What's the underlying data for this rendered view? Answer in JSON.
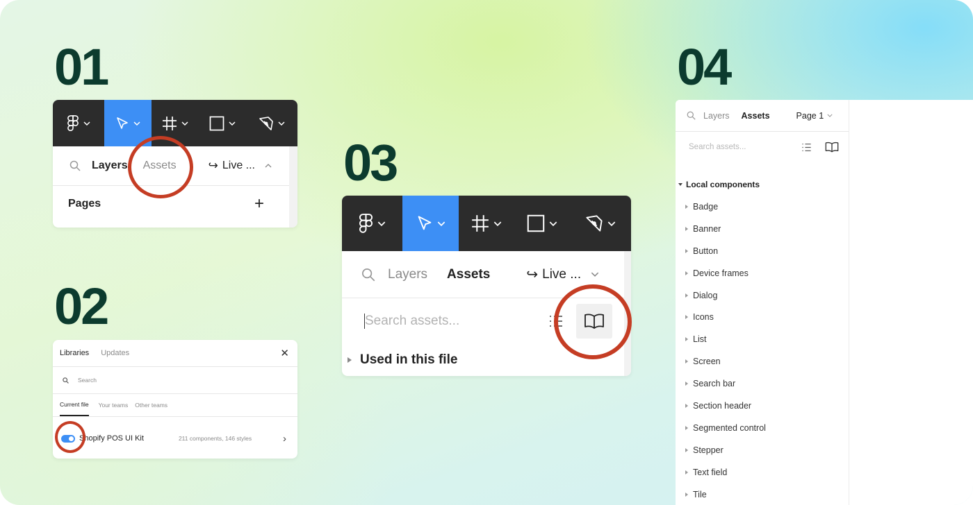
{
  "steps": [
    "01",
    "02",
    "03",
    "04"
  ],
  "step1": {
    "tabs": {
      "layers": "Layers",
      "assets": "Assets",
      "live": "Live ..."
    },
    "pages_label": "Pages",
    "add_symbol": "+"
  },
  "step2": {
    "tabs": {
      "libraries": "Libraries",
      "updates": "Updates"
    },
    "search_placeholder": "Search",
    "filters": {
      "current": "Current file",
      "teams": "Your teams",
      "other": "Other teams"
    },
    "library": {
      "name": "Shopify POS UI Kit",
      "meta": "211 components, 146 styles"
    }
  },
  "step3": {
    "tabs": {
      "layers": "Layers",
      "assets": "Assets",
      "live": "Live ..."
    },
    "search_placeholder": "Search assets...",
    "section": "Used in this file"
  },
  "step4": {
    "tabs": {
      "layers": "Layers",
      "assets": "Assets",
      "page": "Page 1"
    },
    "search_placeholder": "Search assets...",
    "section": "Local components",
    "components": [
      "Badge",
      "Banner",
      "Button",
      "Device frames",
      "Dialog",
      "Icons",
      "List",
      "Screen",
      "Search bar",
      "Section header",
      "Segmented control",
      "Stepper",
      "Text field",
      "Tile"
    ]
  },
  "colors": {
    "accent": "#3d8ff5",
    "highlight": "#c53d24",
    "step_number": "#0c3b2e",
    "toolbar": "#2c2c2c"
  }
}
